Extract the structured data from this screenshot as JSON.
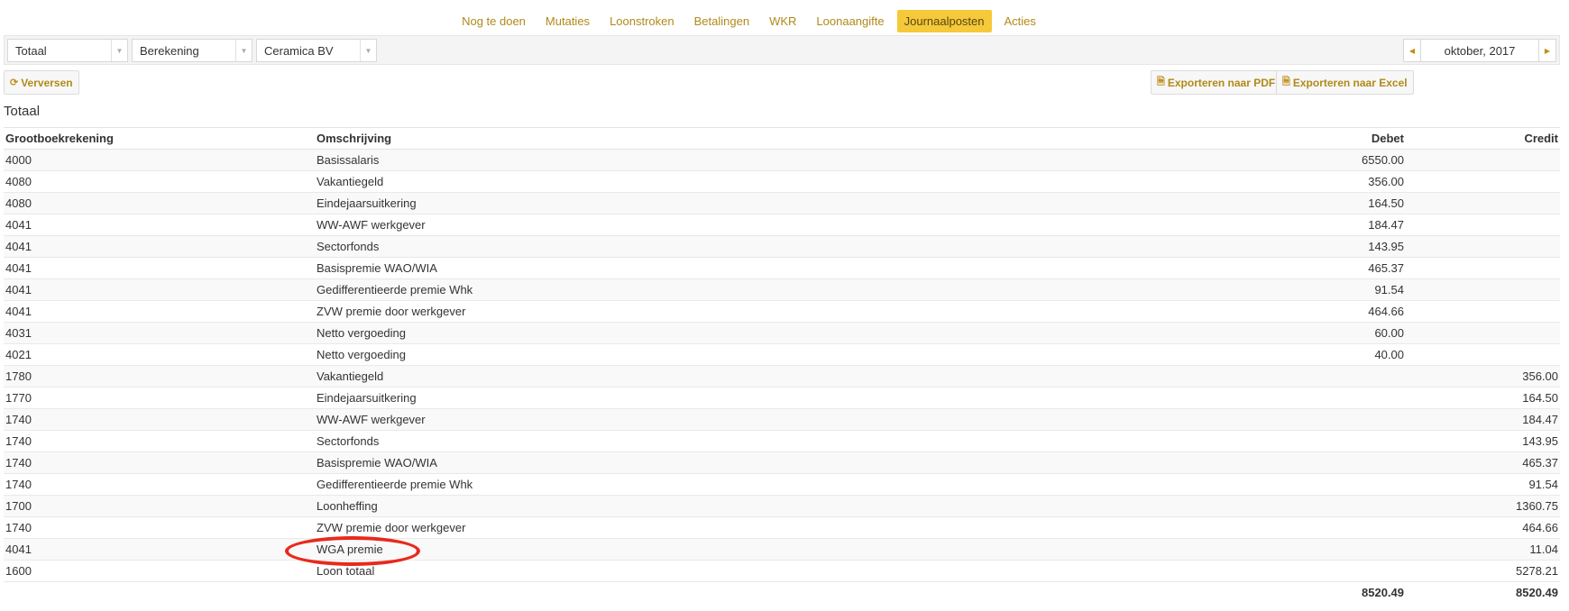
{
  "nav": {
    "tabs": [
      {
        "label": "Nog te doen",
        "active": false
      },
      {
        "label": "Mutaties",
        "active": false
      },
      {
        "label": "Loonstroken",
        "active": false
      },
      {
        "label": "Betalingen",
        "active": false
      },
      {
        "label": "WKR",
        "active": false
      },
      {
        "label": "Loonaangifte",
        "active": false
      },
      {
        "label": "Journaalposten",
        "active": true
      },
      {
        "label": "Acties",
        "active": false
      }
    ]
  },
  "filters": {
    "type_select": "Totaal",
    "mode_select": "Berekening",
    "company_select": "Ceramica BV",
    "period": "oktober, 2017"
  },
  "actions": {
    "refresh": "Verversen",
    "export_pdf": "Exporteren naar PDF",
    "export_excel": "Exporteren naar Excel"
  },
  "section_title": "Totaal",
  "table": {
    "headers": [
      "Grootboekrekening",
      "Omschrijving",
      "Debet",
      "Credit"
    ],
    "rows": [
      {
        "account": "4000",
        "description": "Basissalaris",
        "debit": "6550.00",
        "credit": ""
      },
      {
        "account": "4080",
        "description": "Vakantiegeld",
        "debit": "356.00",
        "credit": ""
      },
      {
        "account": "4080",
        "description": "Eindejaarsuitkering",
        "debit": "164.50",
        "credit": ""
      },
      {
        "account": "4041",
        "description": "WW-AWF werkgever",
        "debit": "184.47",
        "credit": ""
      },
      {
        "account": "4041",
        "description": "Sectorfonds",
        "debit": "143.95",
        "credit": ""
      },
      {
        "account": "4041",
        "description": "Basispremie WAO/WIA",
        "debit": "465.37",
        "credit": ""
      },
      {
        "account": "4041",
        "description": "Gedifferentieerde premie Whk",
        "debit": "91.54",
        "credit": ""
      },
      {
        "account": "4041",
        "description": "ZVW premie door werkgever",
        "debit": "464.66",
        "credit": ""
      },
      {
        "account": "4031",
        "description": "Netto vergoeding",
        "debit": "60.00",
        "credit": ""
      },
      {
        "account": "4021",
        "description": "Netto vergoeding",
        "debit": "40.00",
        "credit": ""
      },
      {
        "account": "1780",
        "description": "Vakantiegeld",
        "debit": "",
        "credit": "356.00"
      },
      {
        "account": "1770",
        "description": "Eindejaarsuitkering",
        "debit": "",
        "credit": "164.50"
      },
      {
        "account": "1740",
        "description": "WW-AWF werkgever",
        "debit": "",
        "credit": "184.47"
      },
      {
        "account": "1740",
        "description": "Sectorfonds",
        "debit": "",
        "credit": "143.95"
      },
      {
        "account": "1740",
        "description": "Basispremie WAO/WIA",
        "debit": "",
        "credit": "465.37"
      },
      {
        "account": "1740",
        "description": "Gedifferentieerde premie Whk",
        "debit": "",
        "credit": "91.54"
      },
      {
        "account": "1700",
        "description": "Loonheffing",
        "debit": "",
        "credit": "1360.75"
      },
      {
        "account": "1740",
        "description": "ZVW premie door werkgever",
        "debit": "",
        "credit": "464.66"
      },
      {
        "account": "4041",
        "description": "WGA premie",
        "debit": "",
        "credit": "11.04"
      },
      {
        "account": "1600",
        "description": "Loon totaal",
        "debit": "",
        "credit": "5278.21"
      }
    ],
    "totals": {
      "debit": "8520.49",
      "credit": "8520.49"
    }
  },
  "colors": {
    "accent": "#f5c93a",
    "link": "#b08a19",
    "annotation": "#e8291c"
  }
}
